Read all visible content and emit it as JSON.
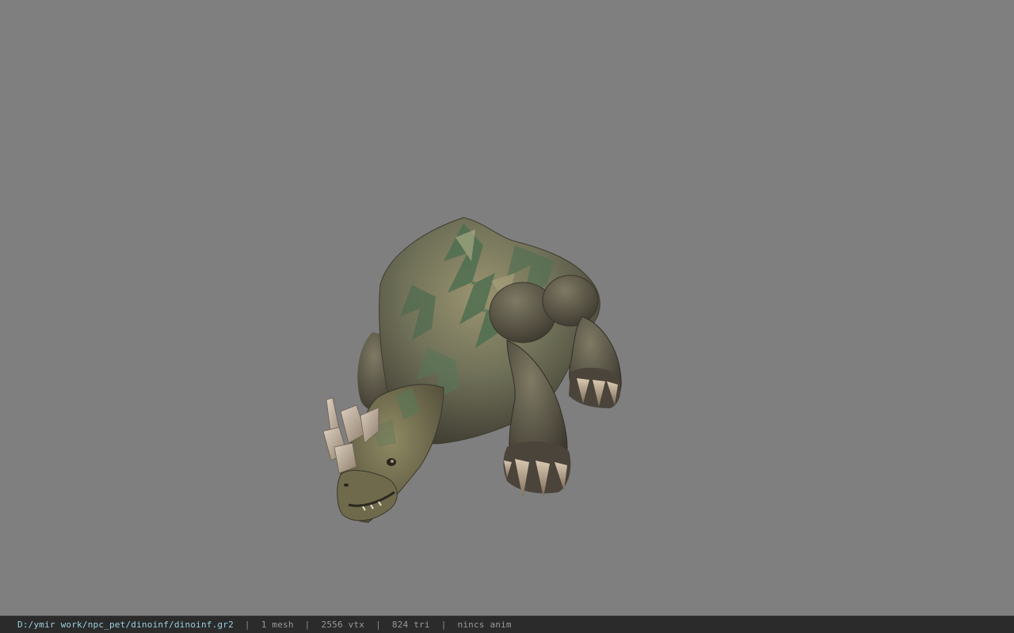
{
  "viewer": {
    "background_color": "#7f7f7f",
    "model_name": "dinoinf"
  },
  "status_bar": {
    "file_path": "D:/ymir work/npc_pet/dinoinf/dinoinf.gr2",
    "separator": "|",
    "mesh_count": "1 mesh",
    "vertex_count": "2556 vtx",
    "triangle_count": "824 tri",
    "animation": "nincs anim",
    "path_color": "#9bd0df",
    "text_color": "#9a9a9a"
  }
}
